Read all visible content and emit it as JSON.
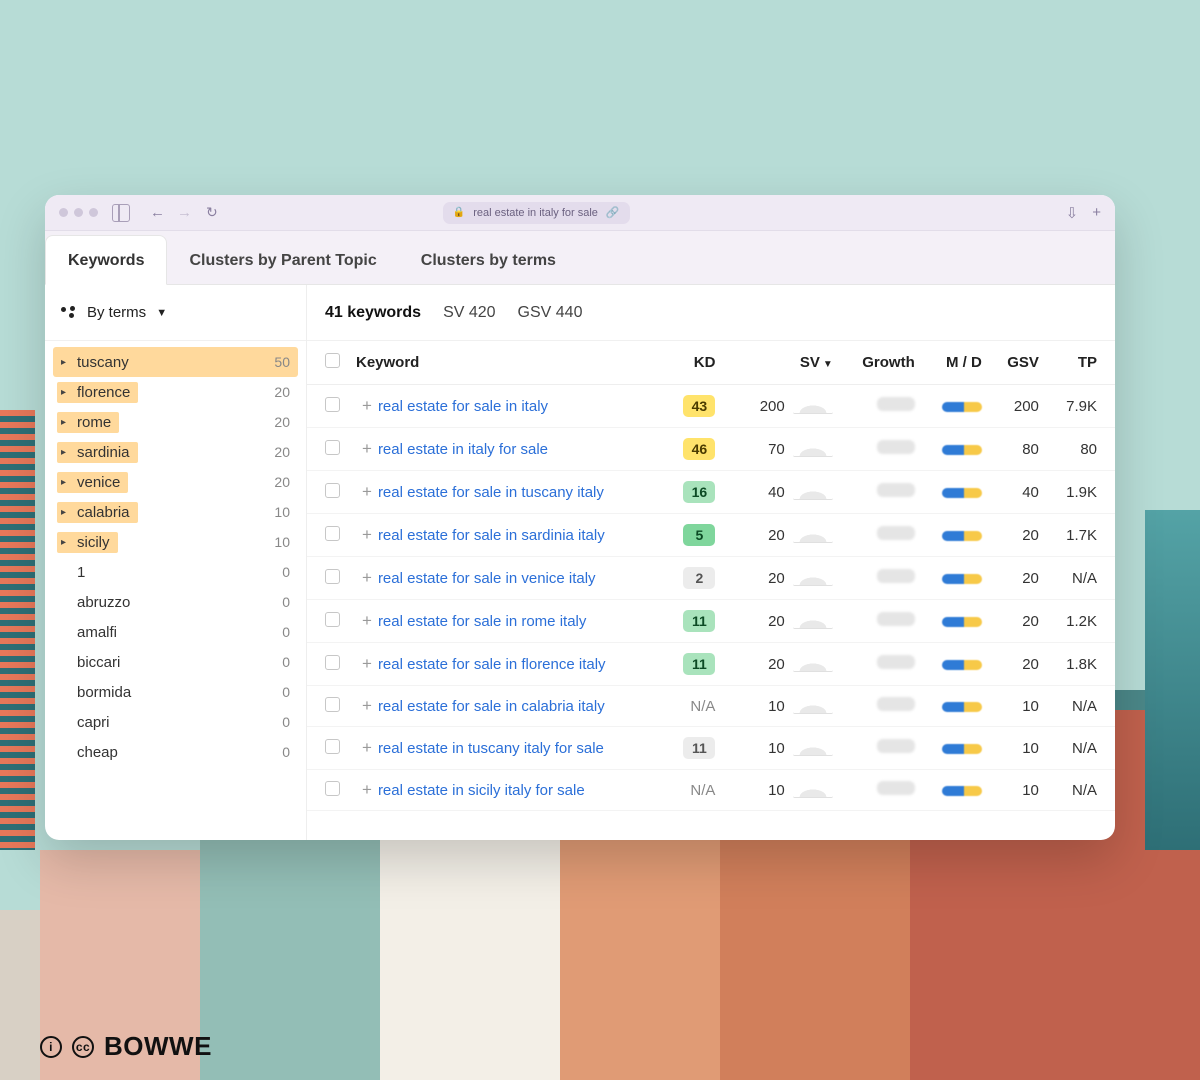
{
  "browser": {
    "url_text": "real estate in italy for sale"
  },
  "tabs": [
    {
      "label": "Keywords",
      "active": true
    },
    {
      "label": "Clusters by Parent Topic",
      "active": false
    },
    {
      "label": "Clusters by terms",
      "active": false
    }
  ],
  "sidebar": {
    "filter_label": "By terms",
    "items": [
      {
        "term": "tuscany",
        "count": 50,
        "expandable": true,
        "highlight": "full"
      },
      {
        "term": "florence",
        "count": 20,
        "expandable": true,
        "highlight": "part"
      },
      {
        "term": "rome",
        "count": 20,
        "expandable": true,
        "highlight": "part"
      },
      {
        "term": "sardinia",
        "count": 20,
        "expandable": true,
        "highlight": "part"
      },
      {
        "term": "venice",
        "count": 20,
        "expandable": true,
        "highlight": "part"
      },
      {
        "term": "calabria",
        "count": 10,
        "expandable": true,
        "highlight": "part"
      },
      {
        "term": "sicily",
        "count": 10,
        "expandable": true,
        "highlight": "part"
      },
      {
        "term": "1",
        "count": 0,
        "expandable": false,
        "highlight": "none"
      },
      {
        "term": "abruzzo",
        "count": 0,
        "expandable": false,
        "highlight": "none"
      },
      {
        "term": "amalfi",
        "count": 0,
        "expandable": false,
        "highlight": "none"
      },
      {
        "term": "biccari",
        "count": 0,
        "expandable": false,
        "highlight": "none"
      },
      {
        "term": "bormida",
        "count": 0,
        "expandable": false,
        "highlight": "none"
      },
      {
        "term": "capri",
        "count": 0,
        "expandable": false,
        "highlight": "none"
      },
      {
        "term": "cheap",
        "count": 0,
        "expandable": false,
        "highlight": "none"
      }
    ]
  },
  "stats": {
    "keywords_count_label": "41 keywords",
    "sv_label": "SV 420",
    "gsv_label": "GSV 440"
  },
  "table": {
    "headers": {
      "keyword": "Keyword",
      "kd": "KD",
      "sv": "SV",
      "growth": "Growth",
      "md": "M / D",
      "gsv": "GSV",
      "tp": "TP"
    },
    "rows": [
      {
        "keyword": "real estate for sale in italy",
        "kd": "43",
        "kd_style": "yellow",
        "sv": "200",
        "gsv": "200",
        "tp": "7.9K"
      },
      {
        "keyword": "real estate in italy for sale",
        "kd": "46",
        "kd_style": "yellow",
        "sv": "70",
        "gsv": "80",
        "tp": "80"
      },
      {
        "keyword": "real estate for sale in tuscany italy",
        "kd": "16",
        "kd_style": "greenL",
        "sv": "40",
        "gsv": "40",
        "tp": "1.9K"
      },
      {
        "keyword": "real estate for sale in sardinia italy",
        "kd": "5",
        "kd_style": "green",
        "sv": "20",
        "gsv": "20",
        "tp": "1.7K"
      },
      {
        "keyword": "real estate for sale in venice italy",
        "kd": "2",
        "kd_style": "grey",
        "sv": "20",
        "gsv": "20",
        "tp": "N/A"
      },
      {
        "keyword": "real estate for sale in rome italy",
        "kd": "11",
        "kd_style": "greenL",
        "sv": "20",
        "gsv": "20",
        "tp": "1.2K"
      },
      {
        "keyword": "real estate for sale in florence italy",
        "kd": "11",
        "kd_style": "greenL",
        "sv": "20",
        "gsv": "20",
        "tp": "1.8K"
      },
      {
        "keyword": "real estate for sale in calabria italy",
        "kd": "N/A",
        "kd_style": "na",
        "sv": "10",
        "gsv": "10",
        "tp": "N/A"
      },
      {
        "keyword": "real estate in tuscany italy for sale",
        "kd": "11",
        "kd_style": "grey",
        "sv": "10",
        "gsv": "10",
        "tp": "N/A"
      },
      {
        "keyword": "real estate in sicily italy for sale",
        "kd": "N/A",
        "kd_style": "na",
        "sv": "10",
        "gsv": "10",
        "tp": "N/A"
      }
    ]
  },
  "footer": {
    "brand": "BOWWE"
  }
}
